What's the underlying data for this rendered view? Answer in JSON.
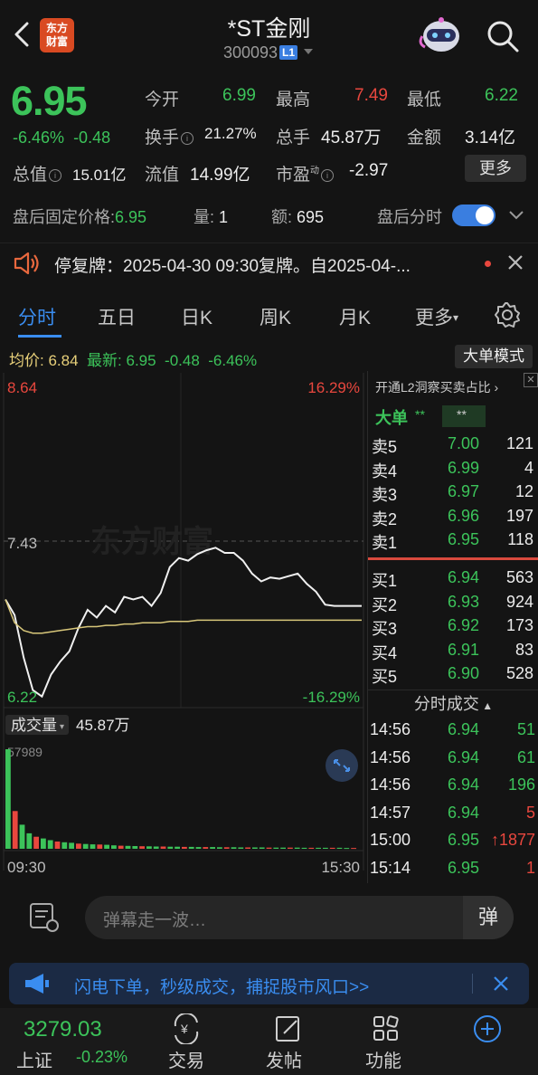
{
  "header": {
    "logo_text_1": "东方",
    "logo_text_2": "财富",
    "title": "*ST金刚",
    "code": "300093",
    "level_badge": "L1",
    "icons": [
      "back-icon",
      "robot-icon",
      "search-icon"
    ]
  },
  "quote": {
    "price": "6.95",
    "change_pct": "-6.46%",
    "change_amt": "-0.48",
    "open_label": "今开",
    "open_value": "6.99",
    "high_label": "最高",
    "high_value": "7.49",
    "low_label": "最低",
    "low_value": "6.22",
    "turnover_label": "换手",
    "turnover_value": "21.27%",
    "volume_label": "总手",
    "volume_value": "45.87万",
    "amount_label": "金额",
    "amount_value": "3.14亿",
    "mktcap_label": "总值",
    "mktcap_value": "15.01亿",
    "float_label": "流值",
    "float_value": "14.99亿",
    "pe_label": "市盈",
    "pe_sup": "动",
    "pe_value": "-2.97",
    "more_button": "更多"
  },
  "after_hours": {
    "fixed_label": "盘后固定价格:",
    "fixed_value": "6.95",
    "qty_label": "量:",
    "qty_value": "1",
    "amt_label": "额:",
    "amt_value": "695",
    "toggle_label": "盘后分时",
    "toggle_on": true
  },
  "notice": {
    "text": "停复牌：2025-04-30 09:30复牌。自2025-04-..."
  },
  "tabs": [
    {
      "label": "分时",
      "active": true
    },
    {
      "label": "五日"
    },
    {
      "label": "日K"
    },
    {
      "label": "周K"
    },
    {
      "label": "月K"
    },
    {
      "label": "更多"
    }
  ],
  "intraday": {
    "avg_label": "均价:",
    "avg_value": "6.84",
    "latest_label": "最新:",
    "latest_value": "6.95",
    "latest_chg": "-0.48",
    "latest_pct": "-6.46%",
    "mode_button": "大单模式",
    "y_top": "8.64",
    "y_top_pct": "16.29%",
    "y_mid": "7.43",
    "y_bottom": "6.22",
    "y_bottom_pct": "-16.29%",
    "watermark": "东方财富",
    "volume_label": "成交量",
    "volume_value": "45.87万",
    "volume_max": "57989",
    "time_start": "09:30",
    "time_end": "15:30"
  },
  "chart_data": {
    "type": "line",
    "ylim": [
      6.22,
      8.64
    ],
    "series": [
      {
        "values": [
          7.0,
          6.88,
          6.55,
          6.3,
          6.25,
          6.42,
          6.52,
          6.6,
          6.78,
          6.92,
          6.86,
          6.95,
          6.9,
          7.02,
          7.0,
          7.02,
          6.95,
          7.05,
          7.25,
          7.32,
          7.3,
          7.35,
          7.38,
          7.4,
          7.36,
          7.36,
          7.3,
          7.2,
          7.14,
          7.17,
          7.16,
          7.18,
          7.2,
          7.12,
          7.06,
          6.96,
          6.95,
          6.95,
          6.95,
          6.95
        ]
      },
      {
        "values": [
          7.0,
          6.82,
          6.76,
          6.74,
          6.74,
          6.75,
          6.76,
          6.77,
          6.78,
          6.79,
          6.79,
          6.8,
          6.8,
          6.81,
          6.81,
          6.82,
          6.82,
          6.82,
          6.83,
          6.83,
          6.83,
          6.84,
          6.84,
          6.84,
          6.84,
          6.84,
          6.84,
          6.84,
          6.84,
          6.84,
          6.84,
          6.84,
          6.84,
          6.84,
          6.84,
          6.84,
          6.84,
          6.84,
          6.84,
          6.84
        ]
      }
    ],
    "volume": [
      57989,
      22000,
      14000,
      9000,
      7000,
      6000,
      5000,
      4200,
      3800,
      3500,
      3000,
      2800,
      2600,
      2500,
      2300,
      2000,
      1800,
      1700,
      1600,
      1500,
      1400,
      1300,
      1300,
      1200,
      1200,
      1100,
      1100,
      1000,
      1000,
      1000,
      900,
      900,
      900,
      800,
      800,
      800,
      800,
      700,
      700,
      700,
      700,
      700,
      600,
      600,
      600,
      600,
      600,
      600,
      500,
      500
    ]
  },
  "l2_panel": {
    "promo": "开通L2洞察买卖占比",
    "big_label": "大单",
    "big_v1": "**",
    "big_v2": "**",
    "asks": [
      {
        "label": "卖5",
        "price": "7.00",
        "qty": "121"
      },
      {
        "label": "卖4",
        "price": "6.99",
        "qty": "4"
      },
      {
        "label": "卖3",
        "price": "6.97",
        "qty": "12"
      },
      {
        "label": "卖2",
        "price": "6.96",
        "qty": "197"
      },
      {
        "label": "卖1",
        "price": "6.95",
        "qty": "118"
      }
    ],
    "bids": [
      {
        "label": "买1",
        "price": "6.94",
        "qty": "563"
      },
      {
        "label": "买2",
        "price": "6.93",
        "qty": "924"
      },
      {
        "label": "买3",
        "price": "6.92",
        "qty": "173"
      },
      {
        "label": "买4",
        "price": "6.91",
        "qty": "83"
      },
      {
        "label": "买5",
        "price": "6.90",
        "qty": "528"
      }
    ],
    "trades_title": "分时成交",
    "trades": [
      {
        "time": "14:56",
        "price": "6.94",
        "qty": "51"
      },
      {
        "time": "14:56",
        "price": "6.94",
        "qty": "61"
      },
      {
        "time": "14:56",
        "price": "6.94",
        "qty": "196"
      },
      {
        "time": "14:57",
        "price": "6.94",
        "qty": "5"
      },
      {
        "time": "15:00",
        "price": "6.95",
        "qty": "↑1877"
      },
      {
        "time": "15:14",
        "price": "6.95",
        "qty": "1"
      }
    ]
  },
  "danmu": {
    "placeholder": "弹幕走一波…",
    "button": "弹"
  },
  "ad": {
    "text": "闪电下单，秒级成交，捕捉股市风口>>"
  },
  "bottom_nav": {
    "index_value": "3279.03",
    "index_name": "上证",
    "index_chg": "-0.23%",
    "items": [
      {
        "label": "交易",
        "icon": "yen-exchange-icon"
      },
      {
        "label": "发帖",
        "icon": "edit-icon"
      },
      {
        "label": "功能",
        "icon": "grid-icon"
      },
      {
        "label": "",
        "icon": "plus-icon"
      }
    ]
  },
  "colors": {
    "down": "#3cc35a",
    "up": "#e8473e",
    "accent": "#3a8df0",
    "avg_line": "#d8c77a"
  }
}
